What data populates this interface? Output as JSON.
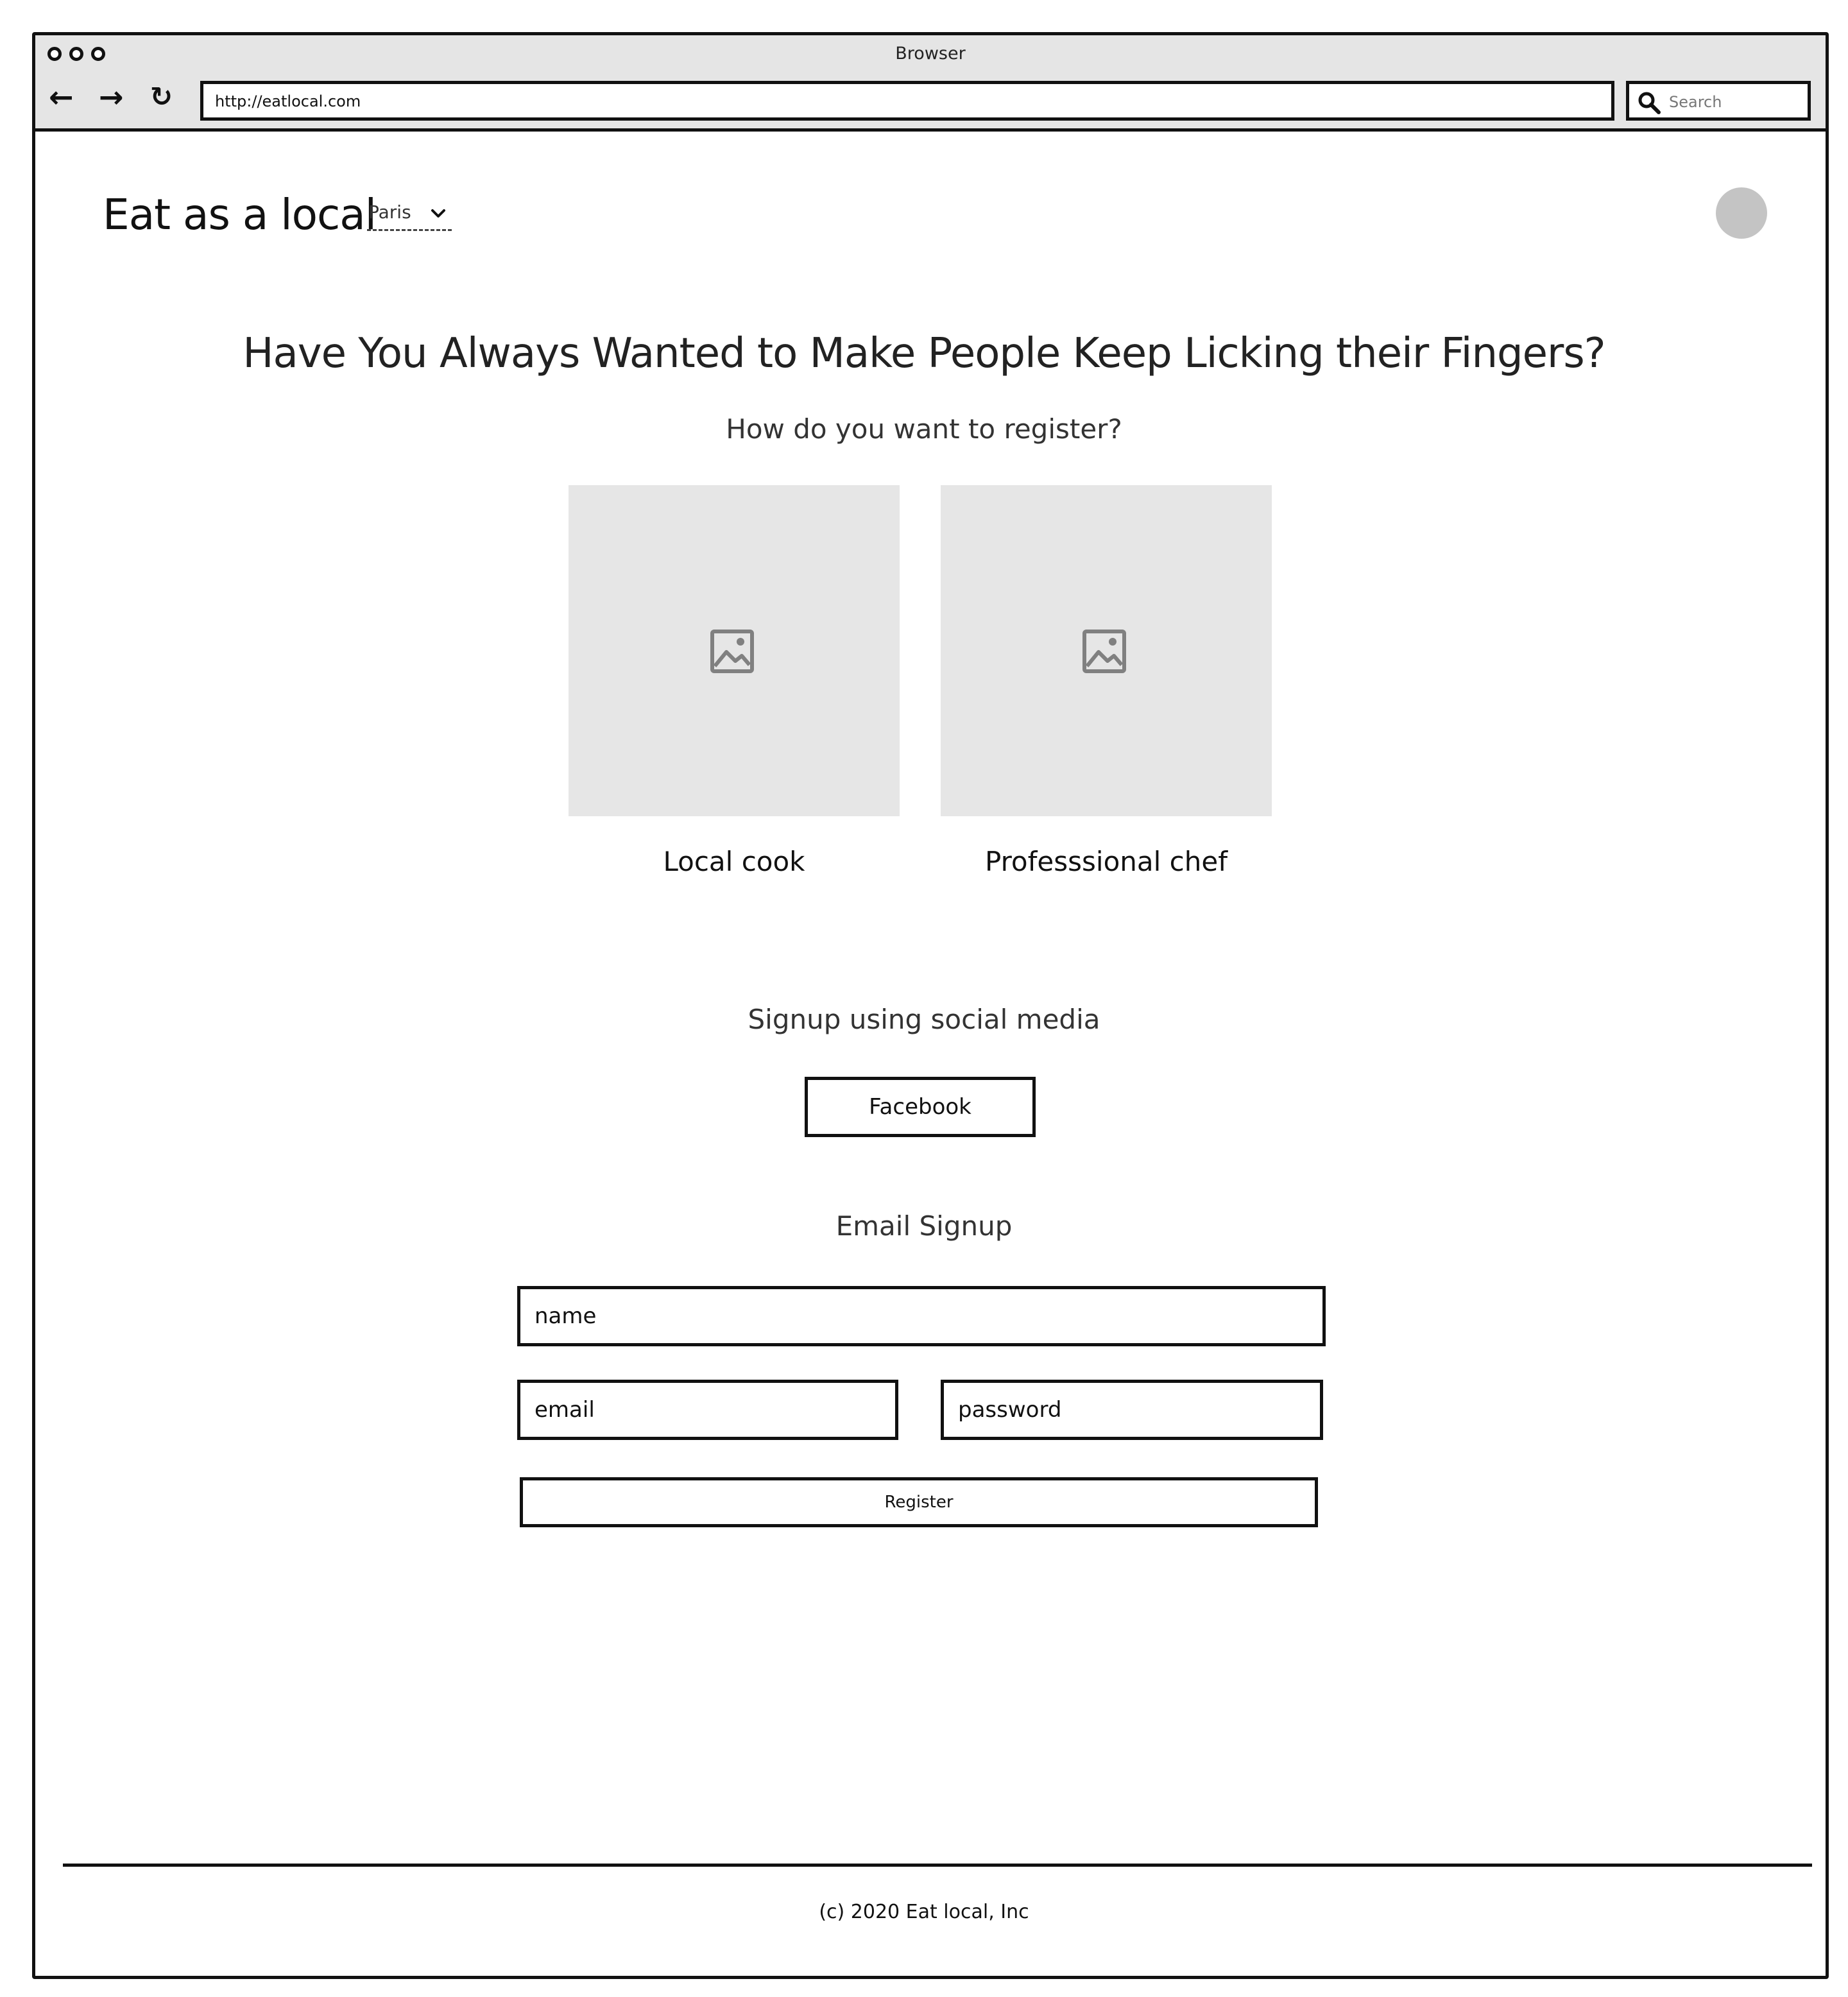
{
  "browser": {
    "title": "Browser",
    "url": "http://eatlocal.com",
    "search_placeholder": "Search"
  },
  "header": {
    "logo": "Eat as a local",
    "city": "Paris"
  },
  "main": {
    "headline": "Have You Always Wanted to Make People Keep Licking their Fingers?",
    "subheadline": "How do you want to register?",
    "options": [
      {
        "label": "Local cook",
        "icon": "image-placeholder-icon"
      },
      {
        "label": "Professsional chef",
        "icon": "image-placeholder-icon"
      }
    ],
    "social": {
      "title": "Signup using social media",
      "facebook_label": "Facebook"
    },
    "email_signup": {
      "title": "Email Signup",
      "name_placeholder": "name",
      "email_placeholder": "email",
      "password_placeholder": "password",
      "register_label": "Register"
    }
  },
  "footer": {
    "copyright": "(c) 2020 Eat local, Inc"
  }
}
